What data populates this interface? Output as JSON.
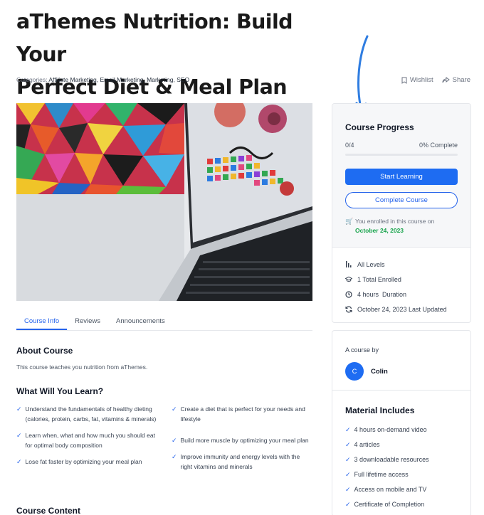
{
  "course": {
    "title_line1": "aThemes Nutrition: Build Your",
    "title_line2": "Perfect Diet & Meal Plan",
    "categories_label": "Categories:",
    "categories": "Affiliate Marketing, Email Marketing, Marketing, SEO"
  },
  "actions": {
    "wishlist": "Wishlist",
    "share": "Share"
  },
  "tabs": [
    {
      "label": "Course Info",
      "active": true
    },
    {
      "label": "Reviews",
      "active": false
    },
    {
      "label": "Announcements",
      "active": false
    }
  ],
  "about": {
    "heading": "About Course",
    "text": "This course teaches you nutrition from aThemes."
  },
  "learn": {
    "heading": "What Will You Learn?",
    "left": [
      "Understand the fundamentals of healthy dieting (calories, protein, carbs, fat, vitamins & minerals)",
      "Learn when, what and how much you should eat for optimal body composition",
      "Lose fat faster by optimizing your meal plan"
    ],
    "right": [
      "Create a diet that is perfect for your needs and lifestyle",
      "Build more muscle by optimizing your meal plan",
      "Improve immunity and energy levels with the right vitamins and minerals"
    ]
  },
  "content_heading": "Course Content",
  "progress": {
    "title": "Course Progress",
    "count": "0/4",
    "percent_text": "0% Complete",
    "fraction": 0,
    "start_label": "Start Learning",
    "complete_label": "Complete Course",
    "enrolled_text": "You enrolled in this course on",
    "enrolled_date": "October 24, 2023"
  },
  "meta": [
    {
      "icon": "level-bars-icon",
      "text": "All Levels"
    },
    {
      "icon": "graduation-cap-icon",
      "text": "1 Total Enrolled"
    },
    {
      "icon": "clock-icon",
      "text": "4 hours  Duration"
    },
    {
      "icon": "refresh-icon",
      "text": "October 24, 2023 Last Updated"
    }
  ],
  "instructor": {
    "label": "A course by",
    "initial": "C",
    "name": "Colin"
  },
  "materials": {
    "title": "Material Includes",
    "items": [
      "4 hours on-demand video",
      "4 articles",
      "3 downloadable resources",
      "Full lifetime access",
      "Access on mobile and TV",
      "Certificate of Completion"
    ]
  },
  "colors": {
    "accent": "#1e6cf2",
    "success": "#16a34a",
    "arrow": "#2f7de1"
  }
}
